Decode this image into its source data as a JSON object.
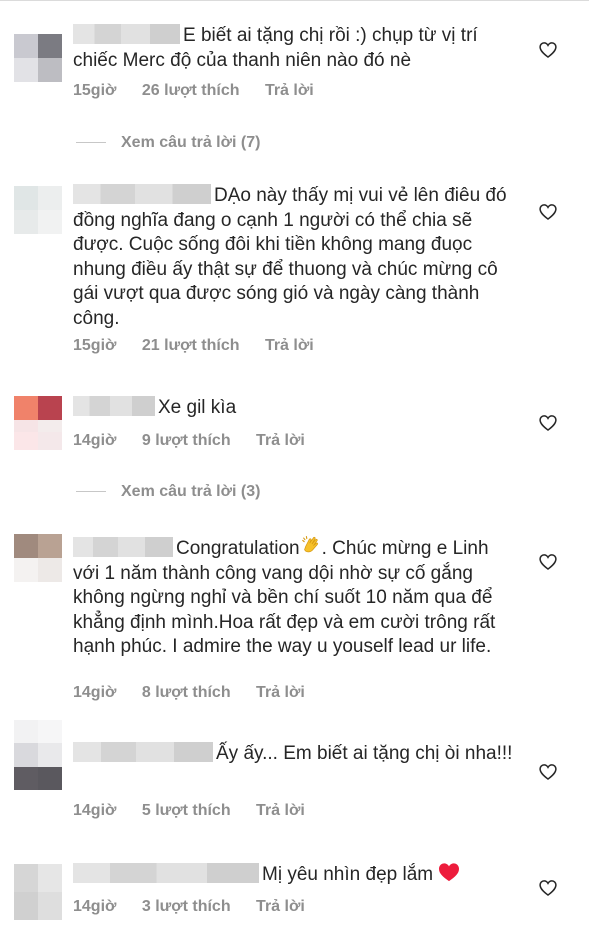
{
  "comments": [
    {
      "text": "E biết ai tặng chị rồi :) chụp từ vị trí chiếc Merc độ của thanh niên nào đó nè",
      "time": "15giờ",
      "likes": "26 lượt thích",
      "reply": "Trả lời",
      "avatar_colors": [
        "#c9c9d0",
        "#7b7b82",
        "#e2e2e6",
        "#bdbdc2"
      ]
    },
    {
      "text": "DẠo này thấy mị vui vẻ lên điêu đó đồng nghĩa đang o cạnh 1 người có thể chia sẽ được. Cuộc sống đôi khi tiền không mang đuọc nhung điều ấy thật sự để thuong và chúc mừng cô gái vượt qua được sóng gió và ngày càng thành công.",
      "time": "15giờ",
      "likes": "21 lượt thích",
      "reply": "Trả lời",
      "avatar_colors": [
        "#e0e6e6",
        "#eceeee",
        "#e7eaea",
        "#f1f2f2"
      ]
    },
    {
      "text": "Xe gil kìa",
      "time": "14giờ",
      "likes": "9 lượt thích",
      "reply": "Trả lời",
      "avatar_colors": [
        "#f0826a",
        "#b9434f",
        "#f6e4e6",
        "#f3ecec"
      ]
    },
    {
      "text": "Congratulation",
      "emoji": "clapping-hands",
      "text_after": ". Chúc mừng e Linh với 1 năm thành công vang dội nhờ sự cố gắng không ngừng nghỉ và bền chí suốt 10 năm qua để khẳng định mình.Hoa rất đẹp và em cười trông rất hạnh phúc. I admire the way u youself lead ur life.",
      "time": "14giờ",
      "likes": "8 lượt thích",
      "reply": "Trả lời",
      "avatar_colors": [
        "#a08a7e",
        "#b9a293",
        "#f4f2f1",
        "#ede9e7"
      ]
    },
    {
      "text": "Ấy ấy... Em biết ai tặng chị òi nha!!!",
      "time": "14giờ",
      "likes": "5 lượt thích",
      "reply": "Trả lời",
      "avatar_colors": [
        "#d9d9dd",
        "#e9e9eb",
        "#5f5c62",
        "#5a585e"
      ]
    },
    {
      "text": "Mị yêu nhìn đẹp lắm",
      "emoji_after": "red-heart",
      "time": "14giờ",
      "likes": "3 lượt thích",
      "reply": "Trả lời",
      "avatar_colors": [
        "#d6d6d6",
        "#e6e6e6",
        "#d0d0d0",
        "#dedede"
      ]
    }
  ],
  "view_replies": [
    {
      "label": "Xem câu trả lời (7)"
    },
    {
      "label": "Xem câu trả lời (3)"
    }
  ],
  "colors": {
    "text": "#262626",
    "meta": "#8e8e8e",
    "heart_emoji": "#ed1c3c",
    "divider": "#c7c7c7"
  },
  "icons": {
    "like": "heart-outline-icon",
    "clap": "clapping-hands-icon",
    "heart": "red-heart-icon"
  }
}
